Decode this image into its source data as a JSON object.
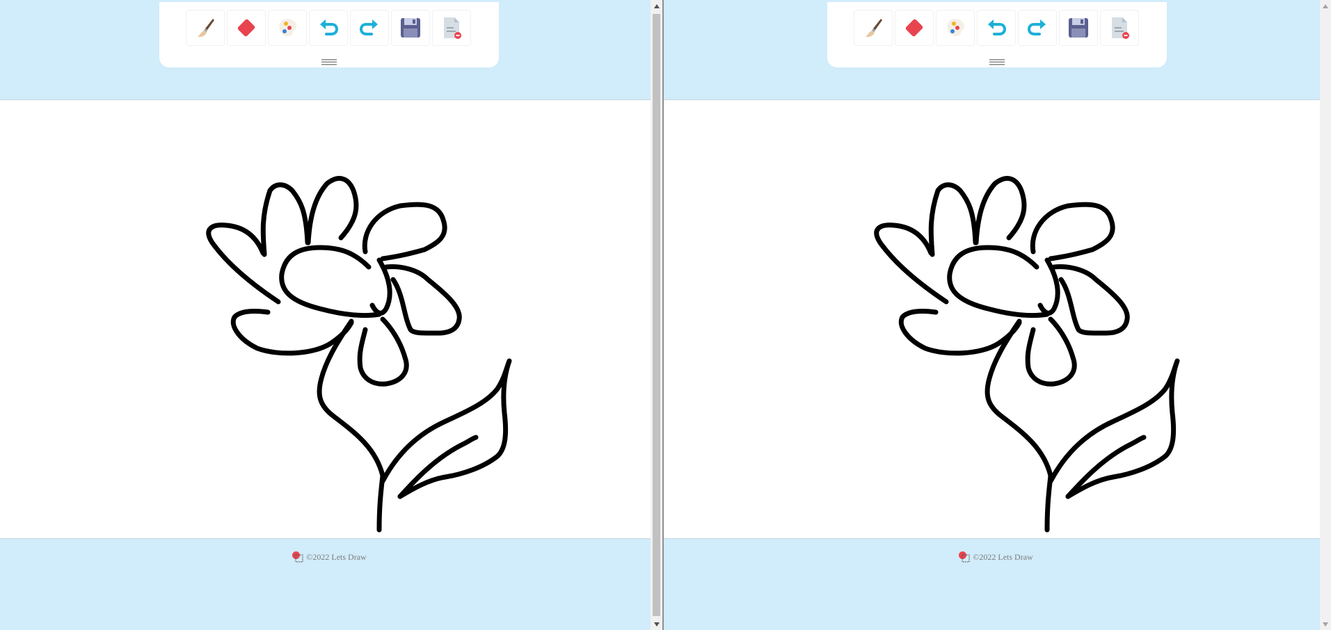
{
  "toolbar": {
    "tools": [
      {
        "id": "brush",
        "icon": "paintbrush-icon"
      },
      {
        "id": "eraser",
        "icon": "eraser-icon"
      },
      {
        "id": "palette",
        "icon": "color-palette-icon"
      },
      {
        "id": "undo",
        "icon": "undo-icon"
      },
      {
        "id": "redo",
        "icon": "redo-icon"
      },
      {
        "id": "save",
        "icon": "floppy-save-icon"
      },
      {
        "id": "clear",
        "icon": "clear-document-icon"
      }
    ],
    "handle_icon": "drag-handle-icon"
  },
  "footer": {
    "text": "©2022 Lets Draw",
    "icon": "lets-draw-logo-icon"
  },
  "colors": {
    "background": "#d1ecfa",
    "canvas": "#ffffff",
    "eraser": "#e8444f",
    "undo_redo": "#1cb0d8",
    "save": "#5b5f8f",
    "stroke": "#000000"
  }
}
